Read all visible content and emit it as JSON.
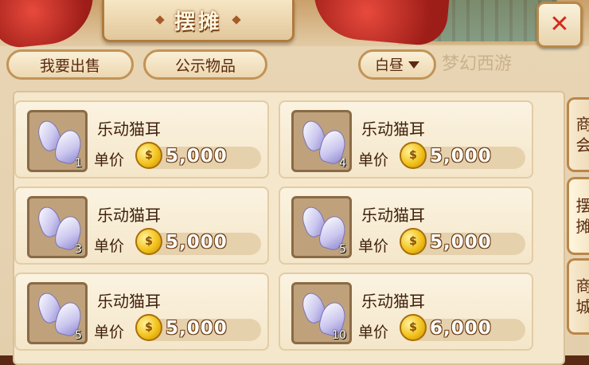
{
  "title": "摆摊",
  "tabs": {
    "sell": "我要出售",
    "public": "公示物品"
  },
  "time_filter": "白昼",
  "watermark": "梦幻西游",
  "price_label": "单价",
  "coin_glyph": "$",
  "items": [
    {
      "name": "乐动猫耳",
      "quantity": "1",
      "price": "5,000"
    },
    {
      "name": "乐动猫耳",
      "quantity": "4",
      "price": "5,000"
    },
    {
      "name": "乐动猫耳",
      "quantity": "3",
      "price": "5,000"
    },
    {
      "name": "乐动猫耳",
      "quantity": "5",
      "price": "5,000"
    },
    {
      "name": "乐动猫耳",
      "quantity": "5",
      "price": "5,000"
    },
    {
      "name": "乐动猫耳",
      "quantity": "10",
      "price": "6,000"
    }
  ],
  "side_tabs": {
    "shop": "商会",
    "stall": "摆摊",
    "mall": "商城"
  },
  "icons": {
    "close": "close-icon",
    "dropdown": "chevron-down-icon",
    "coin": "gold-coin-icon",
    "item": "cat-ear-item-icon"
  },
  "colors": {
    "close_x": "#d42a1d",
    "ribbon": "#c3271f",
    "coin": "#f2c21c"
  }
}
